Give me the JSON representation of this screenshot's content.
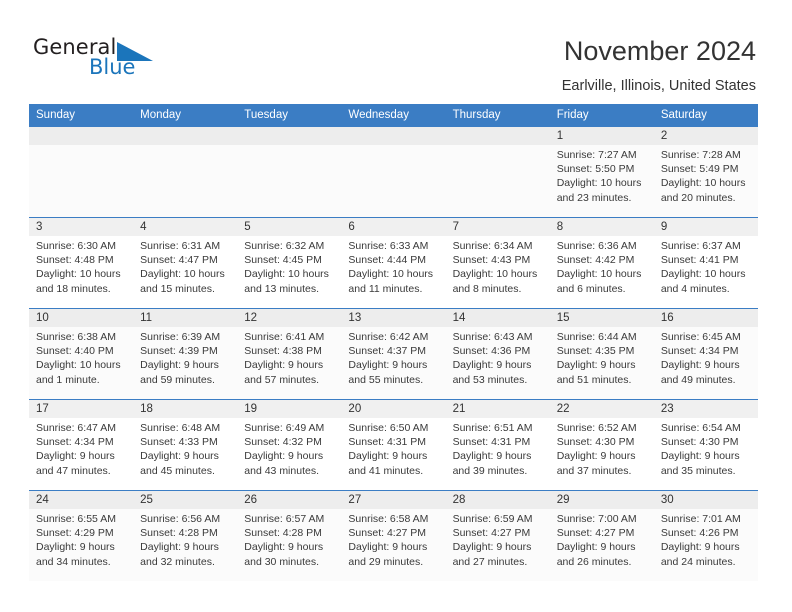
{
  "brand": {
    "name_part1": "General",
    "name_part2": "Blue",
    "accent_color": "#1b75bb",
    "logo_icon": "triangle-flag-icon"
  },
  "header": {
    "title": "November 2024",
    "subtitle": "Earlville, Illinois, United States"
  },
  "theme": {
    "header_row_bg": "#3b7dc4",
    "daynum_band_bg": "#f0f0f0",
    "alt_row_bg": "#fbfbfb",
    "text_color": "#333333"
  },
  "calendar": {
    "weekday_headers": [
      "Sunday",
      "Monday",
      "Tuesday",
      "Wednesday",
      "Thursday",
      "Friday",
      "Saturday"
    ],
    "weeks": [
      [
        {
          "day": "",
          "empty": true
        },
        {
          "day": "",
          "empty": true
        },
        {
          "day": "",
          "empty": true
        },
        {
          "day": "",
          "empty": true
        },
        {
          "day": "",
          "empty": true
        },
        {
          "day": "1",
          "sunrise": "Sunrise: 7:27 AM",
          "sunset": "Sunset: 5:50 PM",
          "daylight": "Daylight: 10 hours and 23 minutes."
        },
        {
          "day": "2",
          "sunrise": "Sunrise: 7:28 AM",
          "sunset": "Sunset: 5:49 PM",
          "daylight": "Daylight: 10 hours and 20 minutes."
        }
      ],
      [
        {
          "day": "3",
          "sunrise": "Sunrise: 6:30 AM",
          "sunset": "Sunset: 4:48 PM",
          "daylight": "Daylight: 10 hours and 18 minutes."
        },
        {
          "day": "4",
          "sunrise": "Sunrise: 6:31 AM",
          "sunset": "Sunset: 4:47 PM",
          "daylight": "Daylight: 10 hours and 15 minutes."
        },
        {
          "day": "5",
          "sunrise": "Sunrise: 6:32 AM",
          "sunset": "Sunset: 4:45 PM",
          "daylight": "Daylight: 10 hours and 13 minutes."
        },
        {
          "day": "6",
          "sunrise": "Sunrise: 6:33 AM",
          "sunset": "Sunset: 4:44 PM",
          "daylight": "Daylight: 10 hours and 11 minutes."
        },
        {
          "day": "7",
          "sunrise": "Sunrise: 6:34 AM",
          "sunset": "Sunset: 4:43 PM",
          "daylight": "Daylight: 10 hours and 8 minutes."
        },
        {
          "day": "8",
          "sunrise": "Sunrise: 6:36 AM",
          "sunset": "Sunset: 4:42 PM",
          "daylight": "Daylight: 10 hours and 6 minutes."
        },
        {
          "day": "9",
          "sunrise": "Sunrise: 6:37 AM",
          "sunset": "Sunset: 4:41 PM",
          "daylight": "Daylight: 10 hours and 4 minutes."
        }
      ],
      [
        {
          "day": "10",
          "sunrise": "Sunrise: 6:38 AM",
          "sunset": "Sunset: 4:40 PM",
          "daylight": "Daylight: 10 hours and 1 minute."
        },
        {
          "day": "11",
          "sunrise": "Sunrise: 6:39 AM",
          "sunset": "Sunset: 4:39 PM",
          "daylight": "Daylight: 9 hours and 59 minutes."
        },
        {
          "day": "12",
          "sunrise": "Sunrise: 6:41 AM",
          "sunset": "Sunset: 4:38 PM",
          "daylight": "Daylight: 9 hours and 57 minutes."
        },
        {
          "day": "13",
          "sunrise": "Sunrise: 6:42 AM",
          "sunset": "Sunset: 4:37 PM",
          "daylight": "Daylight: 9 hours and 55 minutes."
        },
        {
          "day": "14",
          "sunrise": "Sunrise: 6:43 AM",
          "sunset": "Sunset: 4:36 PM",
          "daylight": "Daylight: 9 hours and 53 minutes."
        },
        {
          "day": "15",
          "sunrise": "Sunrise: 6:44 AM",
          "sunset": "Sunset: 4:35 PM",
          "daylight": "Daylight: 9 hours and 51 minutes."
        },
        {
          "day": "16",
          "sunrise": "Sunrise: 6:45 AM",
          "sunset": "Sunset: 4:34 PM",
          "daylight": "Daylight: 9 hours and 49 minutes."
        }
      ],
      [
        {
          "day": "17",
          "sunrise": "Sunrise: 6:47 AM",
          "sunset": "Sunset: 4:34 PM",
          "daylight": "Daylight: 9 hours and 47 minutes."
        },
        {
          "day": "18",
          "sunrise": "Sunrise: 6:48 AM",
          "sunset": "Sunset: 4:33 PM",
          "daylight": "Daylight: 9 hours and 45 minutes."
        },
        {
          "day": "19",
          "sunrise": "Sunrise: 6:49 AM",
          "sunset": "Sunset: 4:32 PM",
          "daylight": "Daylight: 9 hours and 43 minutes."
        },
        {
          "day": "20",
          "sunrise": "Sunrise: 6:50 AM",
          "sunset": "Sunset: 4:31 PM",
          "daylight": "Daylight: 9 hours and 41 minutes."
        },
        {
          "day": "21",
          "sunrise": "Sunrise: 6:51 AM",
          "sunset": "Sunset: 4:31 PM",
          "daylight": "Daylight: 9 hours and 39 minutes."
        },
        {
          "day": "22",
          "sunrise": "Sunrise: 6:52 AM",
          "sunset": "Sunset: 4:30 PM",
          "daylight": "Daylight: 9 hours and 37 minutes."
        },
        {
          "day": "23",
          "sunrise": "Sunrise: 6:54 AM",
          "sunset": "Sunset: 4:30 PM",
          "daylight": "Daylight: 9 hours and 35 minutes."
        }
      ],
      [
        {
          "day": "24",
          "sunrise": "Sunrise: 6:55 AM",
          "sunset": "Sunset: 4:29 PM",
          "daylight": "Daylight: 9 hours and 34 minutes."
        },
        {
          "day": "25",
          "sunrise": "Sunrise: 6:56 AM",
          "sunset": "Sunset: 4:28 PM",
          "daylight": "Daylight: 9 hours and 32 minutes."
        },
        {
          "day": "26",
          "sunrise": "Sunrise: 6:57 AM",
          "sunset": "Sunset: 4:28 PM",
          "daylight": "Daylight: 9 hours and 30 minutes."
        },
        {
          "day": "27",
          "sunrise": "Sunrise: 6:58 AM",
          "sunset": "Sunset: 4:27 PM",
          "daylight": "Daylight: 9 hours and 29 minutes."
        },
        {
          "day": "28",
          "sunrise": "Sunrise: 6:59 AM",
          "sunset": "Sunset: 4:27 PM",
          "daylight": "Daylight: 9 hours and 27 minutes."
        },
        {
          "day": "29",
          "sunrise": "Sunrise: 7:00 AM",
          "sunset": "Sunset: 4:27 PM",
          "daylight": "Daylight: 9 hours and 26 minutes."
        },
        {
          "day": "30",
          "sunrise": "Sunrise: 7:01 AM",
          "sunset": "Sunset: 4:26 PM",
          "daylight": "Daylight: 9 hours and 24 minutes."
        }
      ]
    ]
  }
}
